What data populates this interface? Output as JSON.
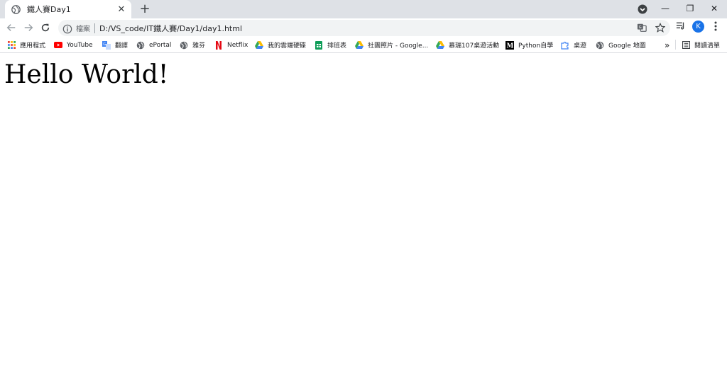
{
  "tab": {
    "title": "鐵人賽Day1",
    "close_glyph": "✕"
  },
  "new_tab_glyph": "+",
  "window": {
    "minimize_glyph": "—",
    "restore_glyph": "❐",
    "close_glyph": "✕"
  },
  "omnibox": {
    "scheme_label": "檔案",
    "url": "D:/VS_code/IT鐵人賽/Day1/day1.html"
  },
  "profile": {
    "initial": "K"
  },
  "bookmarks": [
    {
      "label": "應用程式",
      "icon": "apps-grid-icon"
    },
    {
      "label": "YouTube",
      "icon": "youtube-icon"
    },
    {
      "label": "翻譯",
      "icon": "translate-icon"
    },
    {
      "label": "ePortal",
      "icon": "globe-icon"
    },
    {
      "label": "雅芬",
      "icon": "globe-icon"
    },
    {
      "label": "Netflix",
      "icon": "netflix-icon"
    },
    {
      "label": "我的雲端硬碟",
      "icon": "drive-icon"
    },
    {
      "label": "排班表",
      "icon": "sheets-icon"
    },
    {
      "label": "社團照片 - Google...",
      "icon": "drive-icon"
    },
    {
      "label": "慕瑞107桌遊活動",
      "icon": "drive-icon"
    },
    {
      "label": "Python自學",
      "icon": "medium-icon"
    },
    {
      "label": "桌遊",
      "icon": "puzzle-icon"
    },
    {
      "label": "Google 地圖",
      "icon": "globe-icon"
    }
  ],
  "more_bookmarks_glyph": "»",
  "reading_list": {
    "label": "閱讀清單"
  },
  "content": {
    "heading": "Hello World!"
  },
  "colors": {
    "accent": "#1a73e8",
    "tabstrip": "#dee1e6",
    "omnibox": "#f1f3f4"
  }
}
